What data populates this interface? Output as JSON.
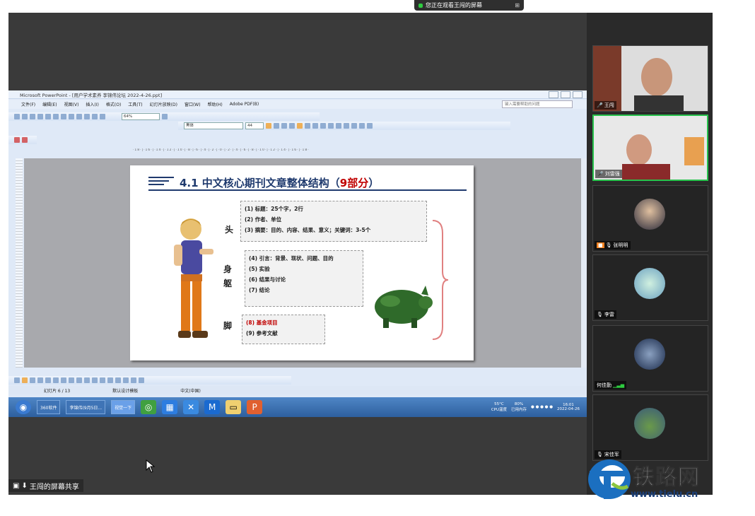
{
  "meeting": {
    "share_banner": "您正在观看王闯的屏幕",
    "bottom_share_label": "王闯的屏幕共享"
  },
  "ppt": {
    "window_title": "Microsoft PowerPoint - [用户学术素养 李锦伟论坛 2022-4-26.ppt]",
    "menu": [
      "文件(F)",
      "编辑(E)",
      "视图(V)",
      "插入(I)",
      "格式(O)",
      "工具(T)",
      "幻灯片放映(D)",
      "窗口(W)",
      "帮助(H)",
      "Adobe PDF(B)"
    ],
    "help_search_placeholder": "键入需要帮助的问题",
    "zoom": "64%",
    "font_name": "黑体",
    "font_size": "44",
    "status": [
      "幻灯片 6 / 13",
      "默认设计模板",
      "中文(中国)"
    ],
    "taskbar": {
      "buttons": [
        "360软件",
        "李锦伟(9月5日...",
        "视觉一下"
      ],
      "tray_temp": "55°C",
      "tray_cpu": "CPU温度",
      "tray_mem": "80%",
      "tray_mem_label": "已用内存",
      "clock_time": "16:01",
      "clock_date": "2022-04-26"
    }
  },
  "slide": {
    "title_main": "4.1 中文核心期刊文章整体结构（",
    "title_highlight": "9部分",
    "title_end": "）",
    "labels": {
      "head": "头",
      "body1": "身",
      "body2": "躯",
      "foot": "脚"
    },
    "head_items": [
      "(1) 标题：25个字，2行",
      "(2) 作者、单位",
      "(3) 摘要：目的、内容、结果、意义；关键词：3-5个"
    ],
    "body_items": [
      "(4) 引言：背景、现状、问题、目的",
      "(5) 实验",
      "(6) 结果与讨论",
      "(7) 结论"
    ],
    "foot_items": [
      "(8) 基金项目",
      "(9) 参考文献"
    ]
  },
  "participants": [
    {
      "name": "王闯"
    },
    {
      "name": "刘雷强"
    },
    {
      "name": "张明明"
    },
    {
      "name": "李雷"
    },
    {
      "name": "何佳勤"
    },
    {
      "name": "宋佳军"
    }
  ],
  "watermark": {
    "text": "铁路网",
    "url": "www.tielu.cn"
  },
  "colors": {
    "title_blue": "#1f3a6e",
    "title_red": "#c00000",
    "active_border": "#27c24c",
    "taskbar": "#2d5f9e"
  }
}
